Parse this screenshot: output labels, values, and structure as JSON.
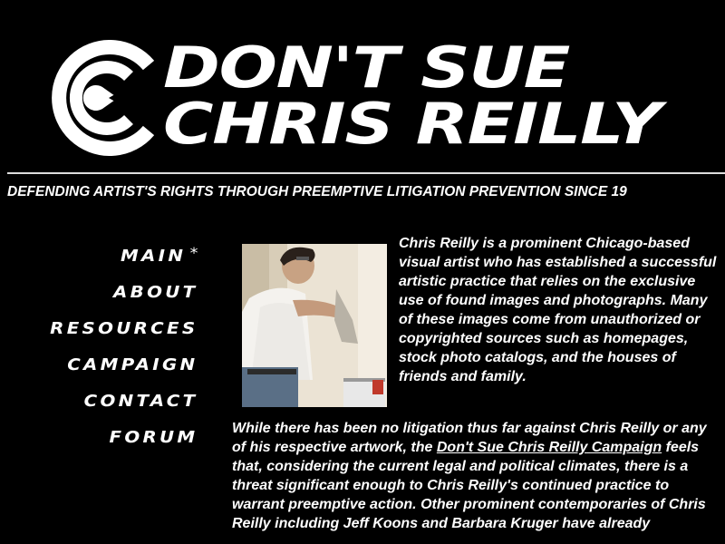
{
  "header": {
    "logo_line1": "DON'T SUE",
    "logo_line2": "CHRIS REILLY",
    "tagline": "DEFENDING ARTIST'S RIGHTS THROUGH PREEMPTIVE LITIGATION PREVENTION SINCE 19"
  },
  "nav": {
    "items": [
      {
        "label": "MAIN",
        "marker": "*"
      },
      {
        "label": "ABOUT"
      },
      {
        "label": "RESOURCES"
      },
      {
        "label": "CAMPAIGN"
      },
      {
        "label": "CONTACT"
      },
      {
        "label": "FORUM"
      }
    ]
  },
  "content": {
    "intro": "Chris Reilly is a prominent Chicago-based visual artist who has established a successful artistic practice that relies on the exclusive use of found images and photographs. Many of these images come from unauthorized or copyrighted sources such as homepages, stock photo catalogs, and the houses of friends and family.",
    "para2_before": "While there has been no litigation thus far against Chris Reilly or any of his respective artwork, the ",
    "para2_link": "Don't Sue Chris Reilly Campaign",
    "para2_after": " feels that, considering the current legal and political climates, there is a threat significant enough to Chris Reilly's continued practice to warrant preemptive action. Other prominent contemporaries of Chris Reilly including Jeff Koons and Barbara Kruger have already"
  },
  "colors": {
    "background": "#000000",
    "text": "#ffffff"
  }
}
